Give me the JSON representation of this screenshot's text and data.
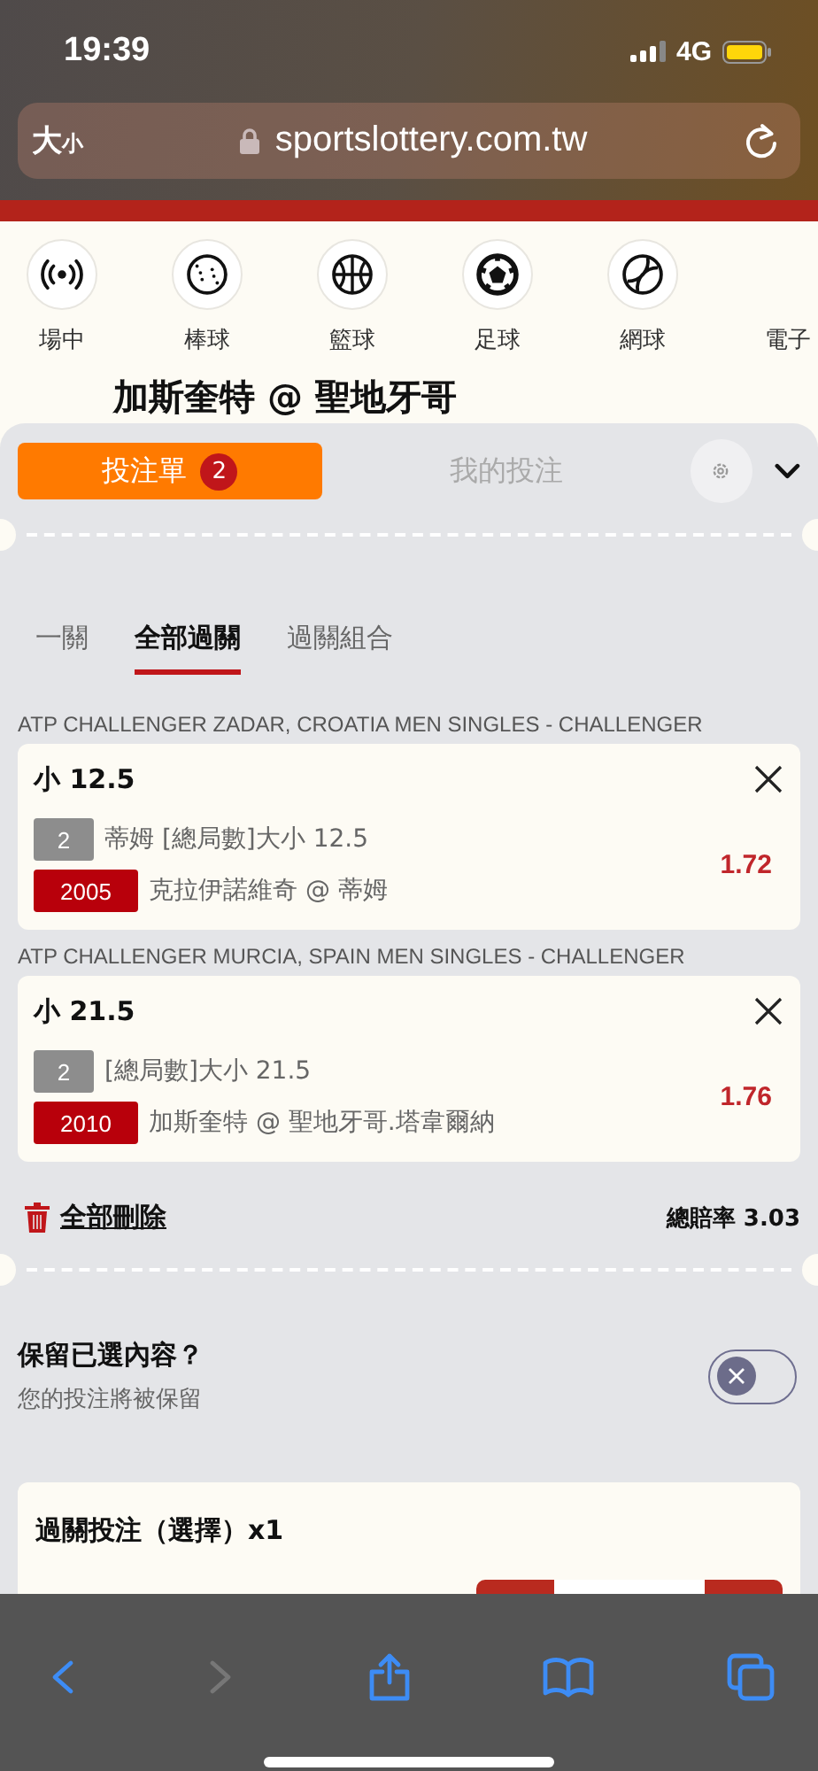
{
  "status_bar": {
    "time": "19:39",
    "network": "4G"
  },
  "address_bar": {
    "text_size_big": "大",
    "text_size_small": "小",
    "url": "sportslottery.com.tw"
  },
  "sports_nav": [
    {
      "kind": "live",
      "label": "場中"
    },
    {
      "kind": "baseball",
      "label": "棒球"
    },
    {
      "kind": "basketball",
      "label": "籃球"
    },
    {
      "kind": "soccer",
      "label": "足球"
    },
    {
      "kind": "tennis",
      "label": "網球"
    },
    {
      "kind": "esports",
      "label": "電子"
    }
  ],
  "event_title": "加斯奎特 @ 聖地牙哥",
  "sheet_tabs": [
    {
      "label": "投注單",
      "badge": "2",
      "selected": true
    },
    {
      "label": "我的投注",
      "selected": false
    }
  ],
  "bet_types": [
    {
      "label": "一關",
      "selected": false
    },
    {
      "label": "全部過關",
      "selected": true
    },
    {
      "label": "過關組合",
      "selected": false
    }
  ],
  "bets": [
    {
      "league": "ATP CHALLENGER ZADAR, CROATIA MEN SINGLES - CHALLENGER",
      "selection": "小 12.5",
      "parlay_min": "2",
      "market": "蒂姆 [總局數]大小 12.5",
      "code": "2005",
      "match": "克拉伊諾維奇 @ 蒂姆",
      "odds": "1.72"
    },
    {
      "league": "ATP CHALLENGER MURCIA, SPAIN MEN SINGLES - CHALLENGER",
      "selection": "小 21.5",
      "parlay_min": "2",
      "market": "[總局數]大小 21.5",
      "code": "2010",
      "match": "加斯奎特 @ 聖地牙哥.塔韋爾納",
      "odds": "1.76"
    }
  ],
  "delete_all": "全部刪除",
  "total_odds": {
    "label": "總賠率",
    "value": "3.03"
  },
  "keep_selections": {
    "title": "保留已選內容？",
    "subtitle": "您的投注將被保留",
    "on": false
  },
  "parlay_card": {
    "title": "過關投注（選擇）x1"
  },
  "toolbar": [
    {
      "kind": "back",
      "disabled": false
    },
    {
      "kind": "forward",
      "disabled": true
    },
    {
      "kind": "share",
      "disabled": false
    },
    {
      "kind": "bookmarks",
      "disabled": false
    },
    {
      "kind": "tabs",
      "disabled": false
    }
  ]
}
